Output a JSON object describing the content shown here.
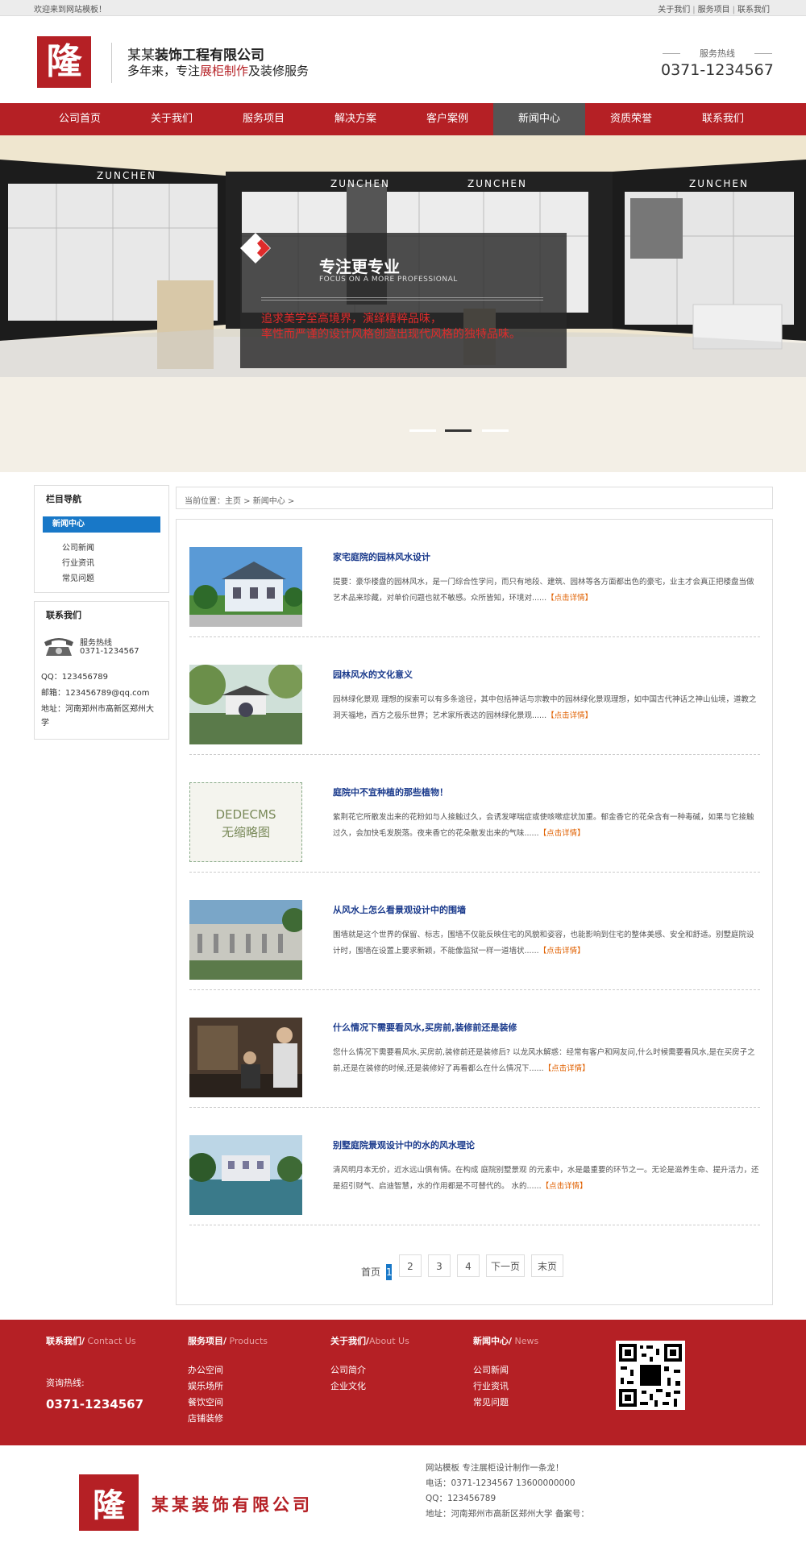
{
  "topbar": {
    "welcome": "欢迎来到网站模板！",
    "links": [
      "关于我们",
      "服务项目",
      "联系我们"
    ],
    "sep": "|"
  },
  "header": {
    "company_prefix": "某某",
    "company_name": "装饰工程有限公司",
    "slogan_a": "多年来，专注",
    "slogan_hl": "展柜制作",
    "slogan_b": "及装修服务",
    "logo_char": "隆",
    "hotline_label": "服务热线",
    "hotline": "0371-1234567"
  },
  "nav": [
    "公司首页",
    "关于我们",
    "服务项目",
    "解决方案",
    "客户案例",
    "新闻中心",
    "资质荣誉",
    "联系我们"
  ],
  "nav_active_index": 5,
  "banner": {
    "brand": "ZUNCHEN",
    "title": "专注更专业",
    "subtitle": "FOCUS ON A MORE PROFESSIONAL",
    "line1": "追求美学至高境界，演绎精粹品味，",
    "line2": "率性而严谨的设计风格创造出现代风格的独特品味。"
  },
  "sidebar": {
    "nav_title": "栏目导航",
    "active": "新闻中心",
    "items": [
      "公司新闻",
      "行业资讯",
      "常见问题"
    ],
    "contact_title": "联系我们",
    "phone_label": "服务热线",
    "phone": "0371-1234567",
    "qq": "QQ：123456789",
    "email": "邮箱：123456789@qq.com",
    "addr1": "地址：河南郑州市高新区郑州大",
    "addr2": "学"
  },
  "breadcrumb": "当前位置：主页 > 新闻中心 >",
  "news": [
    {
      "title": "家宅庭院的园林风水设计",
      "desc": "提要：豪华楼盘的园林风水，是一门综合性学问，而只有地段、建筑、园林等各方面都出色的豪宅，业主才会真正把楼盘当做艺术品来珍藏，对单价问题也就不敏感。众所皆知，环境对......",
      "more": "【点击详情】",
      "thumb": "house"
    },
    {
      "title": "园林风水的文化意义",
      "desc": "园林绿化景观 理想的探索可以有多条途径，其中包括神话与宗教中的园林绿化景观理想，如中国古代神话之神山仙境，道教之洞天福地，西方之极乐世界；艺术家所表达的园林绿化景观......",
      "more": "【点击详情】",
      "thumb": "garden"
    },
    {
      "title": "庭院中不宜种植的那些植物！",
      "desc": "紫荆花它所散发出来的花粉如与人接触过久，会诱发哮喘症或使咳嗽症状加重。郁金香它的花朵含有一种毒碱，如果与它接触过久，会加快毛发脱落。夜来香它的花朵散发出来的气味......",
      "more": "【点击详情】",
      "thumb": "none",
      "thumb_line1": "DEDECMS",
      "thumb_line2": "无缩略图"
    },
    {
      "title": "从风水上怎么看景观设计中的围墙",
      "desc": "围墙就是这个世界的保留、标志，围墙不仅能反映住宅的风貌和姿容，也能影响到住宅的整体美感、安全和舒适。别墅庭院设计时，围墙在设置上要求新颖，不能像监狱一样一道墙状......",
      "more": "【点击详情】",
      "thumb": "wall"
    },
    {
      "title": "什么情况下需要看风水,买房前,装修前还是装修",
      "desc": "您什么情况下需要看风水,买房前,装修前还是装修后? 以龙风水解惑：经常有客户和网友问,什么时候需要看风水,是在买房子之前,还是在装修的时候,还是装修好了再看都么在什么情况下......",
      "more": "【点击详情】",
      "thumb": "office"
    },
    {
      "title": "别墅庭院景观设计中的水的风水理论",
      "desc": "清风明月本无价，近水远山俱有情。在构成 庭院别墅景观 的元素中，水是最重要的环节之一。无论是滋养生命、提升活力，还是招引财气、启迪智慧，水的作用都是不可替代的。 水的......",
      "more": "【点击详情】",
      "thumb": "water"
    }
  ],
  "pager": {
    "first": "首页",
    "current": "1",
    "pages": [
      "2",
      "3",
      "4"
    ],
    "next": "下一页",
    "last": "末页"
  },
  "footer": {
    "cols": [
      {
        "title": "联系我们/",
        "en": " Contact  Us",
        "items": []
      },
      {
        "title": "服务项目/",
        "en": " Products",
        "items": [
          "办公空间",
          "娱乐场所",
          "餐饮空间",
          "店铺装修"
        ]
      },
      {
        "title": "关于我们/",
        "en": "About Us",
        "items": [
          "公司简介",
          "企业文化"
        ]
      },
      {
        "title": "新闻中心/",
        "en": " News",
        "items": [
          "公司新闻",
          "行业资讯",
          "常见问题"
        ]
      }
    ],
    "hotline_label": "资询热线:",
    "hotline": "0371-1234567"
  },
  "bottom": {
    "logo_char": "隆",
    "name": "某某装饰有限公司",
    "line1": "网站模板    专注展柜设计制作一条龙！",
    "line2": "电话：0371-1234567    13600000000",
    "line3": "QQ：123456789",
    "line4": "地址：河南郑州市高新区郑州大学    备案号："
  },
  "colors": {
    "brand_red": "#b52025",
    "nav_active": "#555555",
    "accent_blue": "#1878c8",
    "link_title": "#1a3a8c",
    "more_orange": "#e06000"
  }
}
